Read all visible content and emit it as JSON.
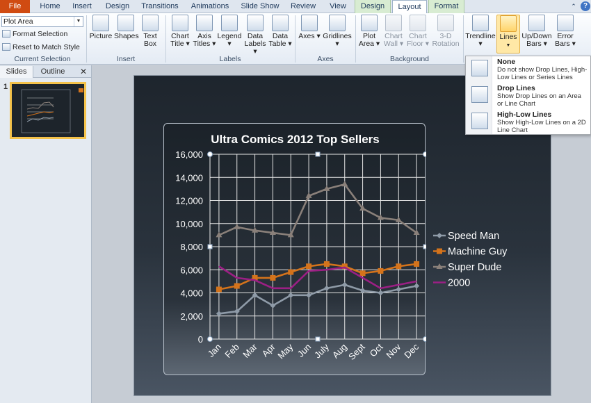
{
  "tabs": [
    "File",
    "Home",
    "Insert",
    "Design",
    "Transitions",
    "Animations",
    "Slide Show",
    "Review",
    "View",
    "Design",
    "Layout",
    "Format"
  ],
  "active_tab": "Layout",
  "ribbon": {
    "current_selection": {
      "combo_value": "Plot Area",
      "format_selection": "Format Selection",
      "reset_style": "Reset to Match Style",
      "group_label": "Current Selection"
    },
    "insert": {
      "picture": "Picture",
      "shapes": "Shapes",
      "text_box_1": "Text",
      "text_box_2": "Box",
      "group_label": "Insert"
    },
    "labels": {
      "chart_title_1": "Chart",
      "chart_title_2": "Title ▾",
      "axis_titles_1": "Axis",
      "axis_titles_2": "Titles ▾",
      "legend": "Legend ▾",
      "data_labels_1": "Data",
      "data_labels_2": "Labels ▾",
      "data_table_1": "Data",
      "data_table_2": "Table ▾",
      "group_label": "Labels"
    },
    "axes": {
      "axes": "Axes ▾",
      "gridlines": "Gridlines ▾",
      "group_label": "Axes"
    },
    "background": {
      "plot_area_1": "Plot",
      "plot_area_2": "Area ▾",
      "chart_wall_1": "Chart",
      "chart_wall_2": "Wall ▾",
      "chart_floor_1": "Chart",
      "chart_floor_2": "Floor ▾",
      "rotation_1": "3-D",
      "rotation_2": "Rotation",
      "group_label": "Background"
    },
    "analysis": {
      "trendline": "Trendline ▾",
      "lines": "Lines",
      "updown_1": "Up/Down",
      "updown_2": "Bars ▾",
      "error_1": "Error",
      "error_2": "Bars ▾"
    }
  },
  "pane": {
    "tab_slides": "Slides",
    "tab_outline": "Outline",
    "close": "✕",
    "slide_number": "1"
  },
  "lines_menu": [
    {
      "title": "None",
      "desc": "Do not show Drop Lines, High-Low Lines or Series Lines"
    },
    {
      "title": "Drop Lines",
      "desc": "Show Drop Lines on an Area or Line Chart"
    },
    {
      "title": "High-Low Lines",
      "desc": "Show High-Low Lines on a 2D Line Chart"
    }
  ],
  "colors": {
    "accent": "#d04b12",
    "speed_man": "#8f9ba8",
    "machine_guy": "#d4731b",
    "super_dude": "#8a807a",
    "y2000": "#9b1f84"
  },
  "chart_data": {
    "type": "line",
    "title": "Ultra Comics 2012 Top Sellers",
    "categories": [
      "Jan",
      "Feb",
      "Mar",
      "Apr",
      "May",
      "Jun",
      "July",
      "Aug",
      "Sept",
      "Oct",
      "Nov",
      "Dec"
    ],
    "yticks": [
      "0",
      "2,000",
      "4,000",
      "6,000",
      "8,000",
      "10,000",
      "12,000",
      "14,000",
      "16,000"
    ],
    "ylim": [
      0,
      16000
    ],
    "grid": true,
    "legend_position": "right",
    "series": [
      {
        "name": "Speed Man",
        "marker": "diamond",
        "values": [
          2200,
          2400,
          3800,
          2900,
          3800,
          3800,
          4400,
          4700,
          4200,
          4000,
          4300,
          4600
        ]
      },
      {
        "name": "Machine Guy",
        "marker": "square",
        "values": [
          4300,
          4600,
          5300,
          5300,
          5800,
          6300,
          6500,
          6300,
          5700,
          5900,
          6300,
          6500
        ]
      },
      {
        "name": "Super Dude",
        "marker": "triangle",
        "values": [
          9000,
          9700,
          9400,
          9200,
          9000,
          12400,
          13000,
          13400,
          11300,
          10500,
          10300,
          9200
        ]
      },
      {
        "name": "2000",
        "marker": "none",
        "values": [
          6300,
          5300,
          5100,
          4400,
          4400,
          5900,
          6000,
          6200,
          5300,
          4400,
          4700,
          5000
        ]
      }
    ]
  }
}
